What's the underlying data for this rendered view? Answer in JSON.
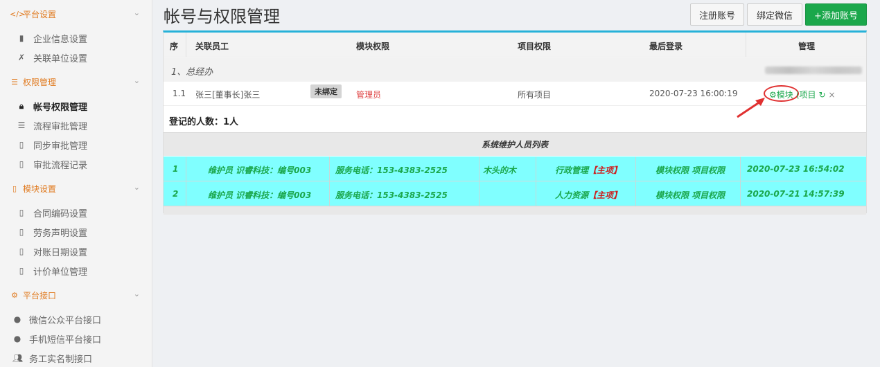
{
  "sidebar": {
    "sections": [
      {
        "label": "平台设置",
        "icon": "code-icon",
        "items": [
          {
            "label": "企业信息设置",
            "icon": "document-icon"
          },
          {
            "label": "关联单位设置",
            "icon": "link-icon"
          }
        ]
      },
      {
        "label": "权限管理",
        "icon": "list-icon",
        "items": [
          {
            "label": "帐号权限管理",
            "icon": "lock-icon",
            "active": true
          },
          {
            "label": "流程审批管理",
            "icon": "list-icon"
          },
          {
            "label": "同步审批管理",
            "icon": "document-icon"
          },
          {
            "label": "审批流程记录",
            "icon": "document-icon"
          }
        ]
      },
      {
        "label": "模块设置",
        "icon": "document-icon",
        "items": [
          {
            "label": "合同编码设置",
            "icon": "document-icon"
          },
          {
            "label": "劳务声明设置",
            "icon": "document-icon"
          },
          {
            "label": "对账日期设置",
            "icon": "document-icon"
          },
          {
            "label": "计价单位管理",
            "icon": "document-icon"
          }
        ]
      },
      {
        "label": "平台接口",
        "icon": "gear-icon",
        "items": [
          {
            "label": "微信公众平台接口",
            "icon": "wechat-icon"
          },
          {
            "label": "手机短信平台接口",
            "icon": "wechat-icon"
          },
          {
            "label": "务工实名制接口",
            "icon": "users-icon"
          }
        ]
      }
    ]
  },
  "page": {
    "title": "帐号与权限管理"
  },
  "toolbar": {
    "register": "注册账号",
    "bind": "绑定微信",
    "add": "+添加账号"
  },
  "table": {
    "headers": [
      "序",
      "关联员工",
      "模块权限",
      "项目权限",
      "最后登录",
      "管理"
    ],
    "group": "1、总经办",
    "row": {
      "index": "1.1",
      "employee": "张三[董事长]张三",
      "badge": "未绑定",
      "module_perm": "管理员",
      "project_perm": "所有项目",
      "last_login": "2020-07-23 16:00:19",
      "actions": {
        "module": "模块",
        "project": "项目"
      }
    },
    "count_label": "登记的人数：1人"
  },
  "maintenance": {
    "title": "系统维护人员列表",
    "rows": [
      {
        "index": "1",
        "role": "维护员 识睿科技：编号003",
        "phone": "服务电话：153-4383-2525",
        "name": "木头的木",
        "dept": "行政管理",
        "tag": "【主项】",
        "perms": "模块权限 项目权限",
        "time": "2020-07-23 16:54:02"
      },
      {
        "index": "2",
        "role": "维护员 识睿科技：编号003",
        "phone": "服务电话：153-4383-2525",
        "name": "",
        "dept": "人力资源",
        "tag": "【主项】",
        "perms": "模块权限 项目权限",
        "time": "2020-07-21 14:57:39"
      }
    ]
  },
  "colors": {
    "accent": "#1aa74b",
    "sidebar_section": "#e07a1f",
    "table_top": "#26b1d8",
    "maint_row": "#80ffff",
    "alert": "#e03030"
  }
}
